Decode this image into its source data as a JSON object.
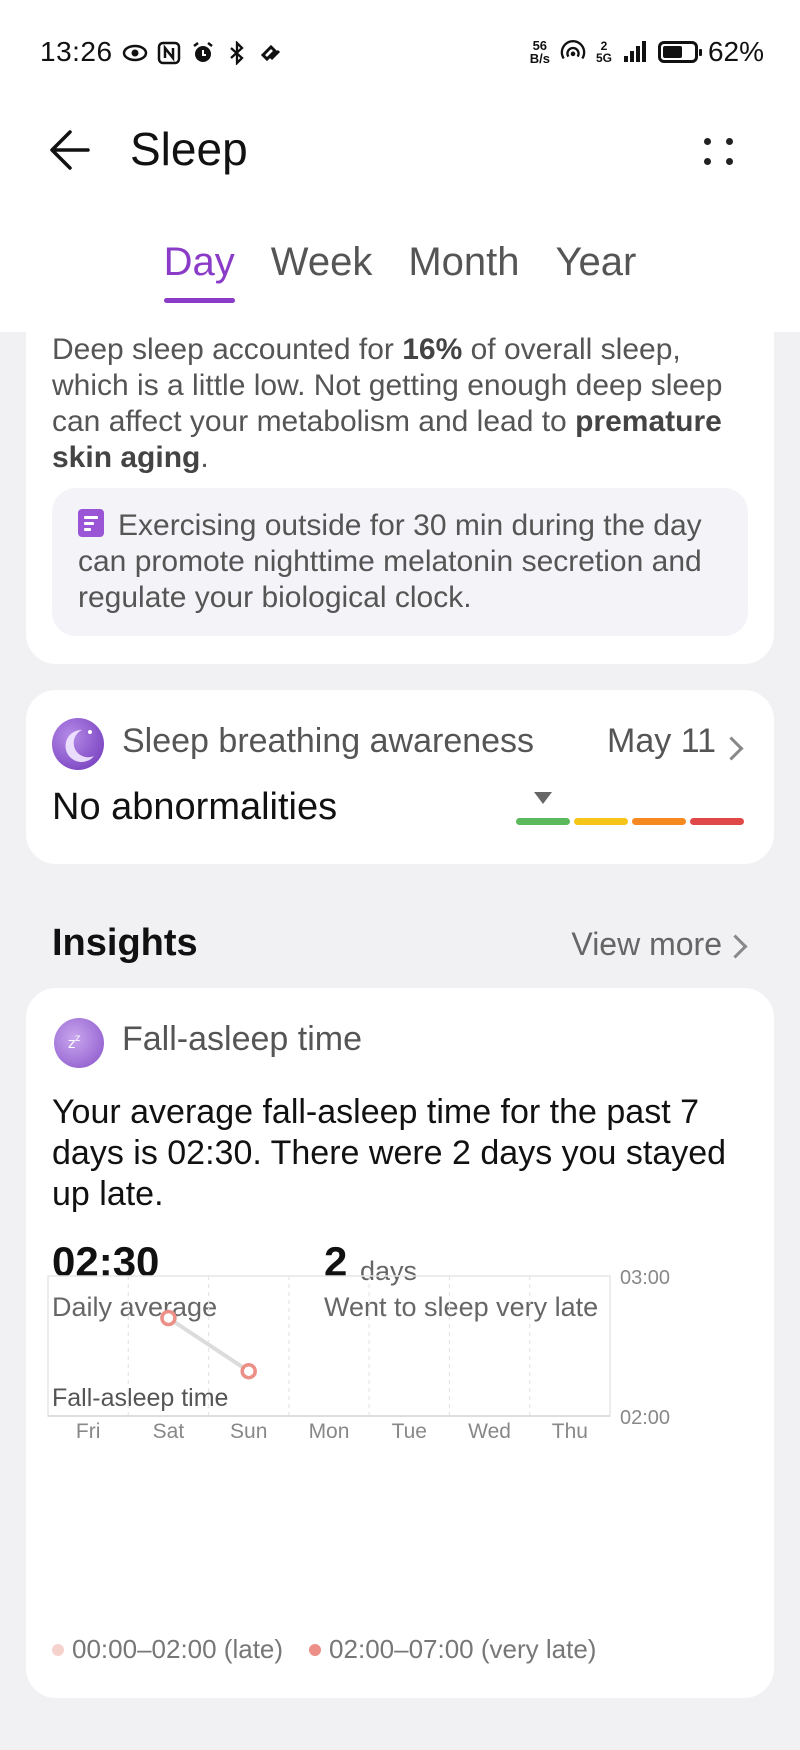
{
  "status_bar": {
    "time": "13:26",
    "net_speed_top": "56",
    "net_speed_bottom": "B/s",
    "network": "5G",
    "sim_index": "2",
    "battery": "62%",
    "battery_level": 0.62,
    "icons": [
      "eye-icon",
      "nfc-icon",
      "alarm-icon",
      "bluetooth-icon",
      "link-icon",
      "hotspot-icon",
      "signal-icon",
      "battery-icon"
    ]
  },
  "header": {
    "title": "Sleep",
    "tabs": [
      {
        "label": "Day",
        "active": true
      },
      {
        "label": "Week",
        "active": false
      },
      {
        "label": "Month",
        "active": false
      },
      {
        "label": "Year",
        "active": false
      }
    ]
  },
  "deep_sleep": {
    "text_before": "Deep sleep accounted for ",
    "percent": "16%",
    "text_middle": " of overall sleep, which is a little low. Not getting enough deep sleep can affect your metabolism and lead to ",
    "emphasis": "premature skin aging",
    "text_after": ".",
    "tip": "Exercising outside for 30 min during the day can promote nighttime melatonin secretion and regulate your biological clock."
  },
  "breathing": {
    "title": "Sleep breathing awareness",
    "date": "May 11",
    "status": "No abnormalities",
    "scale_colors": [
      "#5cb85c",
      "#f5c518",
      "#f5881f",
      "#e04848"
    ]
  },
  "insights": {
    "title": "Insights",
    "view_more": "View more"
  },
  "fall_asleep": {
    "title": "Fall-asleep time",
    "summary": "Your average fall-asleep time for the past 7 days is 02:30. There were 2 days you stayed up late.",
    "avg_value": "02:30",
    "avg_label": "Daily average",
    "late_value": "2",
    "late_unit": "days",
    "late_label": "Went to sleep very late",
    "chart_label": "Fall-asleep time",
    "legend": [
      {
        "label": "00:00–02:00 (late)",
        "color": "#f6d2cd"
      },
      {
        "label": "02:00–07:00 (very late)",
        "color": "#ec8f86"
      }
    ]
  },
  "chart_data": {
    "type": "line",
    "title": "Fall-asleep time",
    "categories": [
      "Fri",
      "Sat",
      "Sun",
      "Mon",
      "Tue",
      "Wed",
      "Thu"
    ],
    "y_ticks": [
      "03:00",
      "02:00"
    ],
    "ylim": [
      2,
      3
    ],
    "series": [
      {
        "values": [
          null,
          2.7,
          2.32,
          null,
          null,
          null,
          null
        ],
        "color": "#ec8f86"
      }
    ]
  }
}
